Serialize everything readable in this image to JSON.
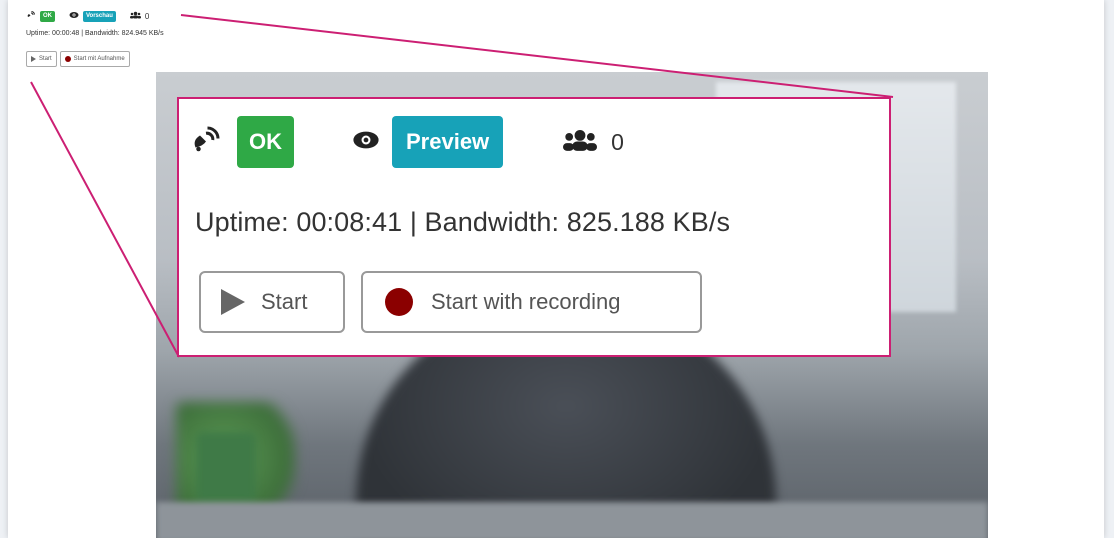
{
  "mini": {
    "status_ok": "OK",
    "status_preview": "Vorschau",
    "viewer_count": "0",
    "uptime_line": "Uptime: 00:00:48 | Bandwidth: 824.945 KB/s",
    "start_label": "Start",
    "record_label": "Start mit Aufnahme"
  },
  "zoom": {
    "status_ok": "OK",
    "status_preview": "Preview",
    "viewer_count": "0",
    "uptime_line": "Uptime: 00:08:41 | Bandwidth: 825.188 KB/s",
    "start_label": "Start",
    "record_label": "Start with recording"
  },
  "colors": {
    "ok_green": "#2fa946",
    "preview_teal": "#17a2b8",
    "record_red": "#8b0000",
    "callout_border": "#cc1f73"
  },
  "icons": [
    "broadcast-icon",
    "eye-icon",
    "users-icon",
    "play-icon",
    "record-icon"
  ]
}
